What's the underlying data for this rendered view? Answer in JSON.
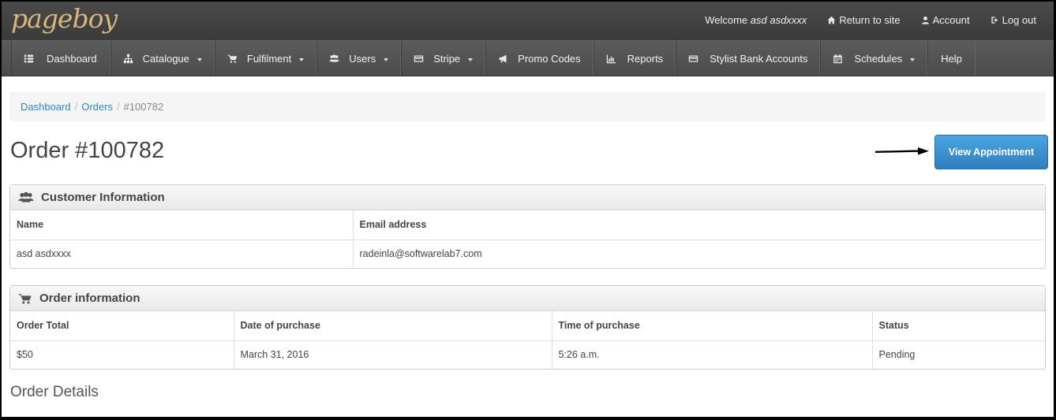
{
  "brand": {
    "logo_text": "pageboy"
  },
  "top_links": {
    "welcome_prefix": "Welcome",
    "welcome_user": "asd asdxxxx",
    "return_to_site": "Return to site",
    "account": "Account",
    "log_out": "Log out"
  },
  "nav": {
    "dashboard": "Dashboard",
    "catalogue": "Catalogue",
    "fulfilment": "Fulfilment",
    "users": "Users",
    "stripe": "Stripe",
    "promo_codes": "Promo Codes",
    "reports": "Reports",
    "stylist_bank_accounts": "Stylist Bank Accounts",
    "schedules": "Schedules",
    "help": "Help"
  },
  "breadcrumb": {
    "dashboard": "Dashboard",
    "orders": "Orders",
    "current": "#100782",
    "separator": "/"
  },
  "page": {
    "title": "Order #100782",
    "view_appointment": "View Appointment"
  },
  "customer_panel": {
    "heading": "Customer Information",
    "columns": {
      "name": "Name",
      "email": "Email address"
    },
    "row": {
      "name": "asd asdxxxx",
      "email": "radeinla@softwarelab7.com"
    }
  },
  "order_panel": {
    "heading": "Order information",
    "columns": {
      "total": "Order Total",
      "date": "Date of purchase",
      "time": "Time of purchase",
      "status": "Status"
    },
    "row": {
      "total": "$50",
      "date": "March 31, 2016",
      "time": "5:26 a.m.",
      "status": "Pending"
    }
  },
  "order_details": {
    "heading": "Order Details"
  },
  "colors": {
    "accent": "#2e7fbd",
    "link": "#2a87c9",
    "topbar": "#3b3b3b",
    "logo": "#d8b67c"
  }
}
